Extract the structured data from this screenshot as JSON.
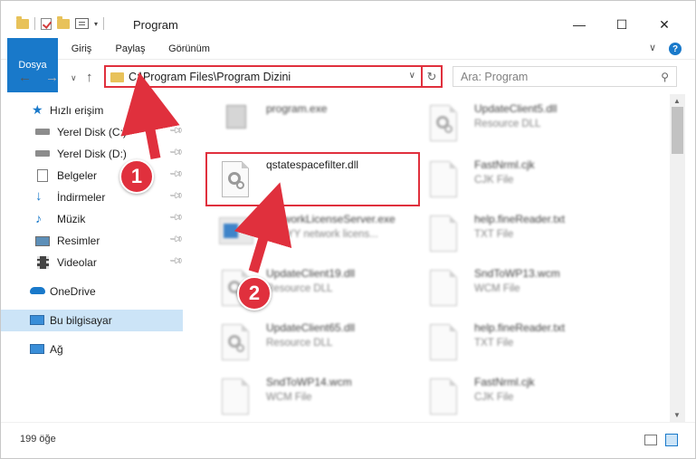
{
  "window": {
    "title": "Program",
    "minimize": "—",
    "maximize": "☐",
    "close": "✕"
  },
  "ribbon": {
    "tabs": [
      "Dosya",
      "Giriş",
      "Paylaş",
      "Görünüm"
    ],
    "collapse": "∨",
    "help": "?"
  },
  "nav": {
    "back": "←",
    "forward": "→",
    "recent": "∨",
    "up": "↑",
    "address_path": "C:\\Program Files\\Program Dizini",
    "address_dropdown": "∨",
    "refresh": "↻",
    "search_placeholder": "Ara: Program"
  },
  "sidebar": {
    "quick_access": "Hızlı erişim",
    "items": [
      {
        "label": "Yerel Disk (C:)",
        "icon": "drive-icon",
        "pinned": true
      },
      {
        "label": "Yerel Disk (D:)",
        "icon": "drive-icon",
        "pinned": true
      },
      {
        "label": "Belgeler",
        "icon": "documents-icon",
        "pinned": true
      },
      {
        "label": "İndirmeler",
        "icon": "downloads-icon",
        "pinned": true
      },
      {
        "label": "Müzik",
        "icon": "music-icon",
        "pinned": true
      },
      {
        "label": "Resimler",
        "icon": "pictures-icon",
        "pinned": true
      },
      {
        "label": "Videolar",
        "icon": "videos-icon",
        "pinned": true
      }
    ],
    "onedrive": "OneDrive",
    "this_pc": "Bu bilgisayar",
    "network": "Ağ"
  },
  "files": [
    {
      "name": "program.exe",
      "type": ""
    },
    {
      "name": "UpdateClient5.dll",
      "type": "Resource DLL"
    },
    {
      "name": "qstatespacefilter.dll",
      "type": ""
    },
    {
      "name": "FastNrml.cjk",
      "type": "CJK File"
    },
    {
      "name": "NetworkLicenseServer.exe",
      "type": "ABBYY network licens..."
    },
    {
      "name": "help.fineReader.txt",
      "type": "TXT File"
    },
    {
      "name": "UpdateClient19.dll",
      "type": "Resource DLL"
    },
    {
      "name": "SndToWP13.wcm",
      "type": "WCM File"
    },
    {
      "name": "UpdateClient65.dll",
      "type": "Resource DLL"
    },
    {
      "name": "help.fineReader.txt",
      "type": "TXT File"
    },
    {
      "name": "SndToWP14.wcm",
      "type": "WCM File"
    },
    {
      "name": "FastNrml.cjk",
      "type": "CJK File"
    }
  ],
  "status": {
    "count": "199 öğe"
  },
  "annotations": [
    "1",
    "2"
  ],
  "colors": {
    "accent": "#1979ca",
    "highlight": "#e0303d",
    "selection": "#cce4f7"
  }
}
